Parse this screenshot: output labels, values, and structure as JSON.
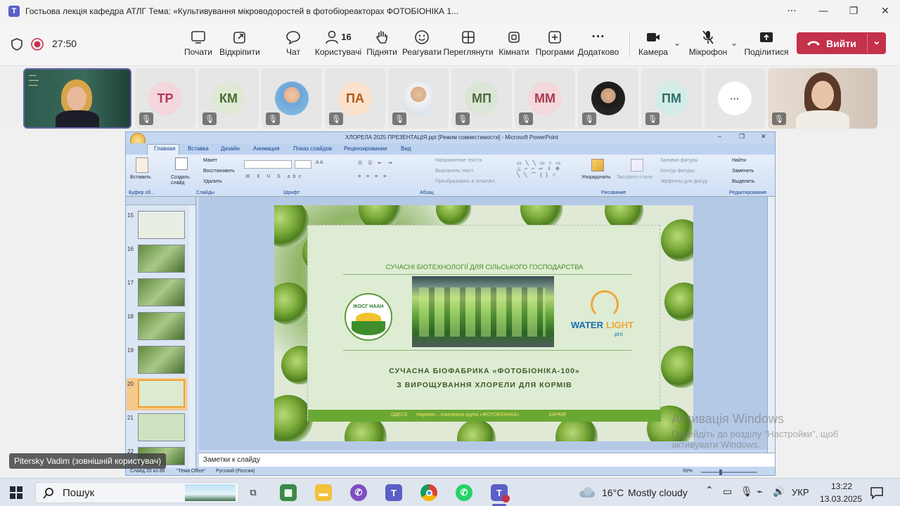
{
  "window": {
    "app_icon_letter": "T",
    "title": "Гостьова лекція кафедра АТЛГ Тема: «Культивування мікроводоростей в фотобіореакторах ФОТОБІОНІКА 1...",
    "more": "···",
    "minimize": "—",
    "maximize": "❐",
    "close": "✕"
  },
  "meeting": {
    "timer": "27:50",
    "controls": [
      {
        "label": "Почати",
        "icon": "⬚"
      },
      {
        "label": "Відкріпити",
        "icon": "⧉"
      },
      {
        "label": "Чат",
        "icon": "💬"
      },
      {
        "label": "Користувачі",
        "icon": "👤",
        "count": "16"
      },
      {
        "label": "Підняти",
        "icon": "✋"
      },
      {
        "label": "Реагувати",
        "icon": "☺"
      },
      {
        "label": "Переглянути",
        "icon": "⊞"
      },
      {
        "label": "Кімнати",
        "icon": "▢"
      },
      {
        "label": "Програми",
        "icon": "⊕"
      },
      {
        "label": "Додатково",
        "icon": "···"
      },
      {
        "label": "Камера",
        "icon": "■"
      },
      {
        "label": "Мікрофон",
        "icon": "🎙"
      },
      {
        "label": "Поділитися",
        "icon": "⬆"
      }
    ],
    "leave_label": "Вийти",
    "shield_icon": "shield-icon",
    "record_color": "#c4314b"
  },
  "participants": [
    {
      "type": "video",
      "bg": "#3f5a3d"
    },
    {
      "type": "initials",
      "initials": "TP",
      "bg": "#f4d6dd",
      "fg": "#b23a5a"
    },
    {
      "type": "initials",
      "initials": "КМ",
      "bg": "#dfe9d5",
      "fg": "#4a6b2f"
    },
    {
      "type": "photo",
      "bg": "#cfe0ef"
    },
    {
      "type": "initials",
      "initials": "ПА",
      "bg": "#fbe2cc",
      "fg": "#b05a18"
    },
    {
      "type": "photo",
      "bg": "#e9e1d4"
    },
    {
      "type": "initials",
      "initials": "МП",
      "bg": "#dbe6d6",
      "fg": "#4e6b3f"
    },
    {
      "type": "initials",
      "initials": "ММ",
      "bg": "#f3d8dc",
      "fg": "#a93a4d"
    },
    {
      "type": "photo",
      "bg": "#2c2c2c"
    },
    {
      "type": "initials",
      "initials": "ПМ",
      "bg": "#d3ece8",
      "fg": "#2f6e68"
    },
    {
      "type": "more",
      "initials": "···",
      "bg": "#ffffff",
      "fg": "#555"
    },
    {
      "type": "video",
      "bg": "#d4c7bd"
    }
  ],
  "powerpoint": {
    "title": "ХЛОРЕЛА 2025 ПРЕЗЕНТАЦІЯ.ppt [Режим совместимости] - Microsoft PowerPoint",
    "tabs": [
      "Главная",
      "Вставка",
      "Дизайн",
      "Анимация",
      "Показ слайдов",
      "Рецензирование",
      "Вид"
    ],
    "ribbon": {
      "paste": "Вставить",
      "create_slide": "Создать слайд",
      "layout": "Макет",
      "reset": "Восстановить",
      "delete": "Удалить",
      "groups": [
        "Буфер об...",
        "Слайды",
        "Шрифт",
        "Абзац",
        "Рисование",
        "Редактирование"
      ],
      "text_direction": "Направление текста",
      "align_text": "Выровнять текст",
      "smartart": "Преобразовать в SmartArt",
      "arrange": "Упорядочить",
      "quick_styles": "Экспресс-стили",
      "fill": "Заливка фигуры",
      "outline": "Контур фигуры",
      "effects": "Эффекты для фигур",
      "find": "Найти",
      "replace": "Заменить",
      "select": "Выделить"
    },
    "thumbnails": [
      "15",
      "16",
      "17",
      "18",
      "19",
      "20",
      "21",
      "22"
    ],
    "selected_slide": "20",
    "slide": {
      "heading": "СУЧАСНІ БІОТЕХНОЛОГІЇ ДЛЯ СІЛЬСЬКОГО ГОСПОДАРСТВА",
      "left_logo_text": "ІКОСГ НААН",
      "right_logo_main": "WATER",
      "right_logo_accent": "LIGHT",
      "right_logo_sub": ".pro",
      "title_line1": "СУЧАСНА БІОФАБРИКА «ФОТОБІОНІКА-100»",
      "title_line2": "З ВИРОЩУВАННЯ ХЛОРЕЛИ ДЛЯ КОРМІВ",
      "footer_left": "ОДЕСА",
      "footer_mid": "Науково – інженерна група «ФОТОБІОНІКА»",
      "footer_right": "ХАРКІВ",
      "accent": "#6aa834"
    },
    "notes": "Заметки к слайду",
    "status": {
      "slide": "Слайд 20 из 86",
      "theme": "\"Тема Office\"",
      "lang": "Русский (Россия)",
      "zoom": "69%"
    }
  },
  "overlay": {
    "activation_title": "Активація Windows",
    "activation_sub1": "Перейдіть до розділу \"Настройки\", щоб",
    "activation_sub2": "активувати Windows.",
    "presenter_name": "Pitersky Vadim (зовнішній користувач)"
  },
  "taskbar": {
    "search": "Пошук",
    "weather_temp": "16°C",
    "weather_desc": "Mostly cloudy",
    "lang": "УКР",
    "time": "13:22",
    "date": "13.03.2025"
  }
}
